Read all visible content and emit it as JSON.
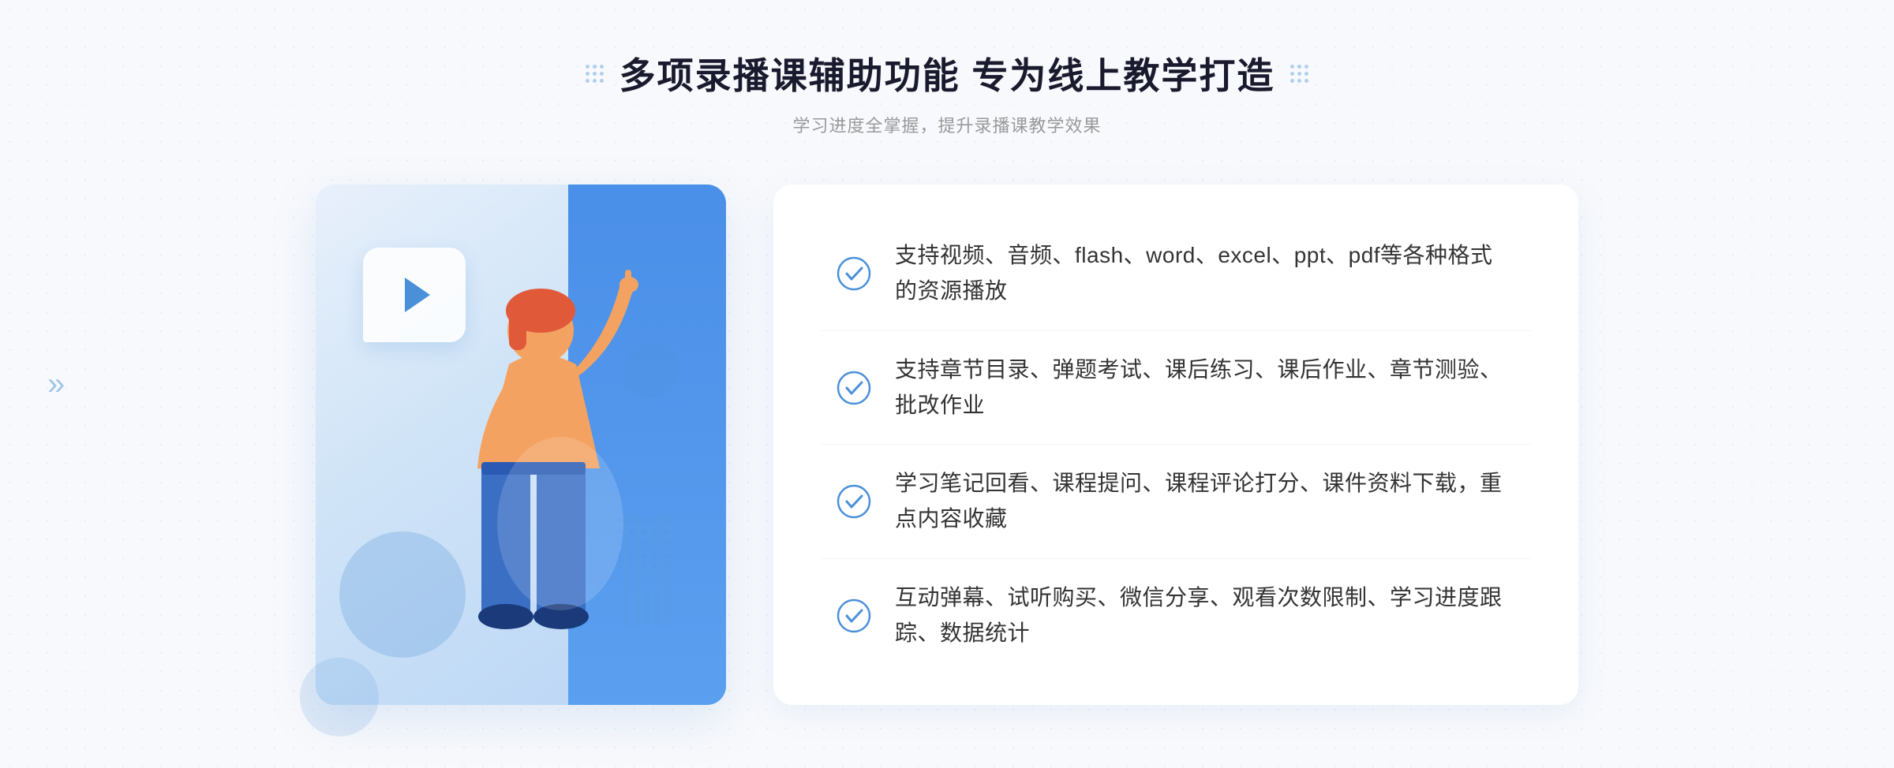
{
  "page": {
    "background_color": "#f8f9fc"
  },
  "header": {
    "title": "多项录播课辅助功能 专为线上教学打造",
    "subtitle": "学习进度全掌握，提升录播课教学效果"
  },
  "features": [
    {
      "id": 1,
      "text": "支持视频、音频、flash、word、excel、ppt、pdf等各种格式的资源播放"
    },
    {
      "id": 2,
      "text": "支持章节目录、弹题考试、课后练习、课后作业、章节测验、批改作业"
    },
    {
      "id": 3,
      "text": "学习笔记回看、课程提问、课程评论打分、课件资料下载，重点内容收藏"
    },
    {
      "id": 4,
      "text": "互动弹幕、试听购买、微信分享、观看次数限制、学习进度跟踪、数据统计"
    }
  ],
  "icons": {
    "check_circle": "check-circle-icon",
    "play": "play-icon",
    "chevron_left": "«",
    "chevron_right": "»"
  }
}
